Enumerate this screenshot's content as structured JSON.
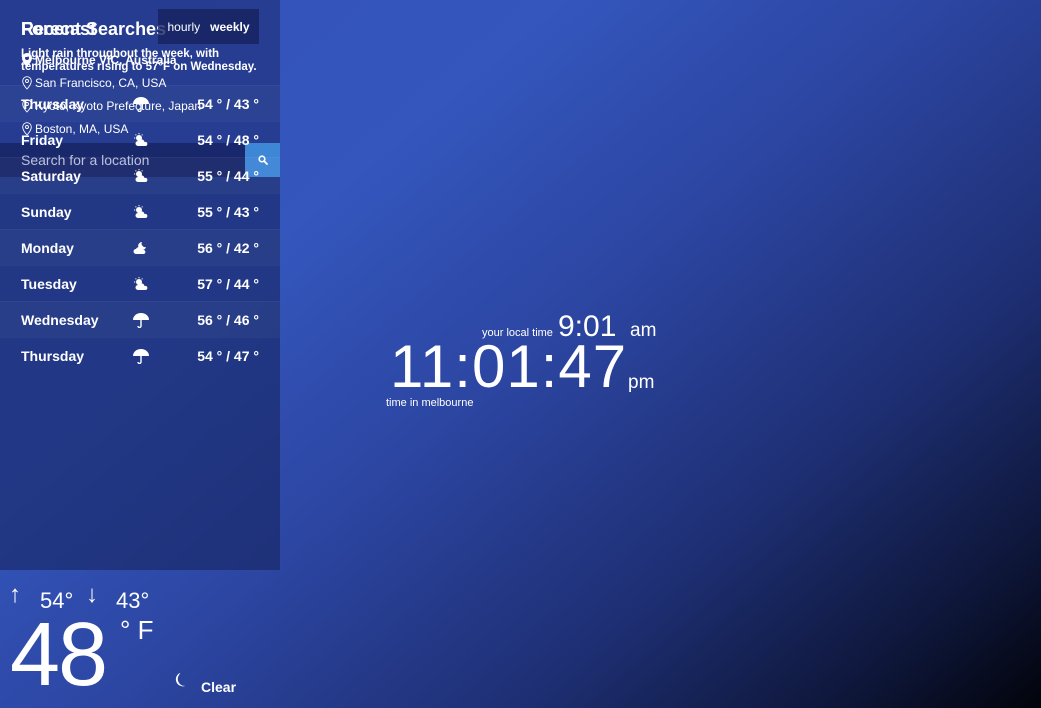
{
  "recent": {
    "title": "Recent Searches",
    "items": [
      {
        "label": "Melbourne VIC, Australia",
        "active": true
      },
      {
        "label": "San Francisco, CA, USA",
        "active": false
      },
      {
        "label": "Kyoto, Kyoto Prefecture, Japan",
        "active": false
      },
      {
        "label": "Boston, MA, USA",
        "active": false
      }
    ],
    "search_placeholder": "Search for a location",
    "search_icon": "search-icon"
  },
  "forecast": {
    "title": "Forecast",
    "toggle": {
      "hourly": "hourly",
      "weekly": "weekly",
      "selected": "weekly"
    },
    "summary": "Light rain throughout the week, with temperatures rising to 57°F on Wednesday.",
    "days": [
      {
        "day": "Thursday",
        "icon": "umbrella-icon",
        "temps": "54 ° / 43 °"
      },
      {
        "day": "Friday",
        "icon": "partly-cloudy-icon",
        "temps": "54 ° / 48 °"
      },
      {
        "day": "Saturday",
        "icon": "partly-cloudy-icon",
        "temps": "55 ° / 44 °"
      },
      {
        "day": "Sunday",
        "icon": "partly-cloudy-icon",
        "temps": "55 ° / 43 °"
      },
      {
        "day": "Monday",
        "icon": "partly-cloudy-night-icon",
        "temps": "56 ° / 42 °"
      },
      {
        "day": "Tuesday",
        "icon": "partly-cloudy-icon",
        "temps": "57 ° / 44 °"
      },
      {
        "day": "Wednesday",
        "icon": "umbrella-icon",
        "temps": "56 ° / 46 °"
      },
      {
        "day": "Thursday",
        "icon": "umbrella-icon",
        "temps": "54 ° / 47 °"
      }
    ]
  },
  "clock": {
    "local_label": "your local time",
    "local_time": "9:01",
    "local_ampm": "am",
    "main_time": "11:01:47",
    "main_ampm": "pm",
    "city_label": "time in melbourne"
  },
  "current": {
    "high_arrow": "↑",
    "high": "54°",
    "low_arrow": "↓",
    "low": "43°",
    "temp": "48",
    "unit": "° F",
    "condition": "Clear",
    "condition_icon": "moon-icon"
  },
  "colors": {
    "accent": "#3e86d6",
    "bg_top": "#3352b8",
    "bg_bottom": "#02030a"
  }
}
